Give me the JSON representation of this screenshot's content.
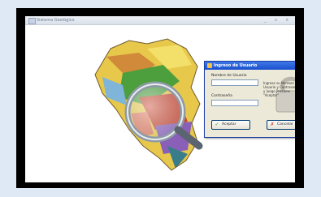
{
  "app": {
    "title": "Sistema Geológico",
    "window_buttons": "_ ▫ x"
  },
  "dialog": {
    "title": "Ingreso de Usuario",
    "username_label": "Nombre de Usuario",
    "username_value": "",
    "password_label": "Contraseña",
    "password_value": "",
    "info_text": "Ingrese su Nombre de Usuario y Contraseña y luego Presione \"Aceptar\"",
    "accept_label": "Aceptar",
    "cancel_label": "Cancelar",
    "close_glyph": "✕"
  },
  "colors": {
    "frame": "#000000",
    "titlebar": "#1a4fcc",
    "map_yellow": "#e8c84a",
    "map_green": "#4d9e3c",
    "map_red": "#c8452e"
  },
  "icons": {
    "accept": "check-icon",
    "cancel": "x-icon",
    "magnifier": "magnifier-icon",
    "lock": "lock-icon"
  }
}
